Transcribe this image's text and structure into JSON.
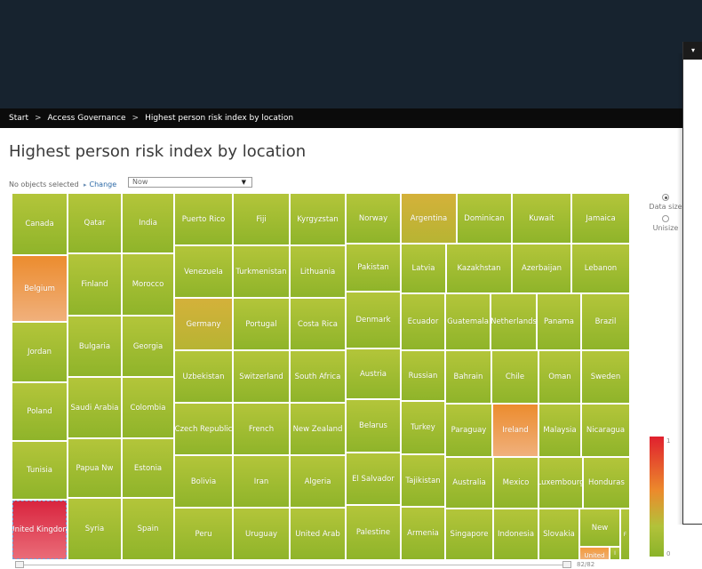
{
  "breadcrumb": {
    "items": [
      "Start",
      "Access Governance",
      "Highest person risk index by location"
    ],
    "separator": ">"
  },
  "page": {
    "title": "Highest person risk index by location"
  },
  "toolbar": {
    "selection_text": "No objects selected",
    "change_label": "Change",
    "time_select_value": "Now"
  },
  "colors": {
    "low_risk": "#8fb42a",
    "medium_risk": "#ec8c2e",
    "high_risk": "#d9243e",
    "header_bg": "#17232f"
  },
  "treemap": {
    "cells": [
      "Canada",
      "Belgium",
      "Jordan",
      "Poland",
      "Tunisia",
      "United Kingdom",
      "Qatar",
      "Finland",
      "Bulgaria",
      "Saudi Arabia",
      "Papua Nw",
      "Syria",
      "India",
      "Morocco",
      "Georgia",
      "Colombia",
      "Estonia",
      "Spain",
      "Puerto Rico",
      "Venezuela",
      "Germany",
      "Uzbekistan",
      "Czech Republic",
      "Bolivia",
      "Peru",
      "Fiji",
      "Turkmenistan",
      "Portugal",
      "Switzerland",
      "French",
      "Iran",
      "Uruguay",
      "Kyrgyzstan",
      "Lithuania",
      "Costa Rica",
      "South Africa",
      "New Zealand",
      "Algeria",
      "United Arab",
      "Norway",
      "Pakistan",
      "Denmark",
      "Austria",
      "Belarus",
      "El Salvador",
      "Palestine",
      "Argentina",
      "Latvia",
      "Ecuador",
      "Russian",
      "Turkey",
      "Tajikistan",
      "Armenia",
      "Dominican",
      "Kazakhstan",
      "Guatemala",
      "Bahrain",
      "Paraguay",
      "Australia",
      "Singapore",
      "Kuwait",
      "Azerbaijan",
      "Netherlands",
      "Panama",
      "Chile",
      "Ireland",
      "Mexico",
      "Indonesia",
      "Oman",
      "Malaysia",
      "Luxembourg",
      "Slovakia",
      "Jamaica",
      "Lebanon",
      "Brazil",
      "Sweden",
      "Nicaragua",
      "Honduras",
      "New",
      "United",
      "I",
      "F"
    ]
  },
  "options": {
    "data_size_label": "Data size",
    "unisize_label": "Unisize",
    "selected": "Data size"
  },
  "legend": {
    "max_label": "1",
    "min_label": "0"
  },
  "pager": {
    "text": "82/82"
  }
}
